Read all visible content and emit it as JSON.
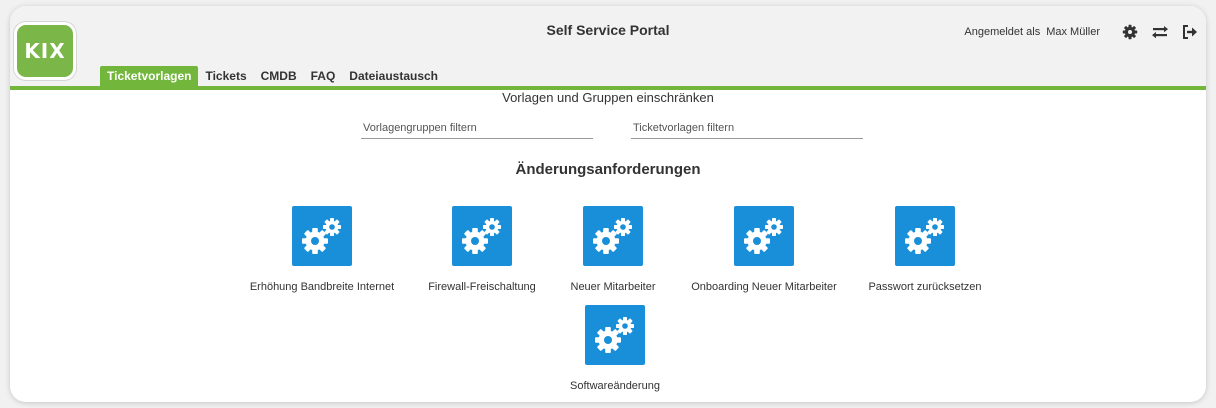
{
  "app": {
    "logo": "KIX",
    "title": "Self Service Portal"
  },
  "user": {
    "logged_in_label": "Angemeldet als",
    "name": "Max Müller"
  },
  "header_icons": [
    "gear-icon",
    "swap-icon",
    "logout-icon"
  ],
  "tabs": [
    {
      "label": "Ticketvorlagen",
      "active": true
    },
    {
      "label": "Tickets",
      "active": false
    },
    {
      "label": "CMDB",
      "active": false
    },
    {
      "label": "FAQ",
      "active": false
    },
    {
      "label": "Dateiaustausch",
      "active": false
    }
  ],
  "filters": {
    "heading": "Vorlagen und Gruppen einschränken",
    "group_filter": {
      "placeholder": "Vorlagengruppen filtern",
      "value": ""
    },
    "template_filter": {
      "placeholder": "Ticketvorlagen filtern",
      "value": ""
    }
  },
  "group": {
    "title": "Änderungsanforderungen",
    "templates": [
      {
        "label": "Erhöhung Bandbreite Internet",
        "icon": "gears-icon"
      },
      {
        "label": "Firewall-Freischaltung",
        "icon": "gears-icon"
      },
      {
        "label": "Neuer Mitarbeiter",
        "icon": "gears-icon"
      },
      {
        "label": "Onboarding Neuer Mitarbeiter",
        "icon": "gears-icon"
      },
      {
        "label": "Passwort zurücksetzen",
        "icon": "gears-icon"
      },
      {
        "label": "Softwareänderung",
        "icon": "gears-icon"
      }
    ]
  },
  "colors": {
    "accent_green": "#73b63c",
    "logo_green": "#7ab648",
    "tile_blue": "#1a8fd9",
    "header_bg": "#f2f2f2"
  }
}
